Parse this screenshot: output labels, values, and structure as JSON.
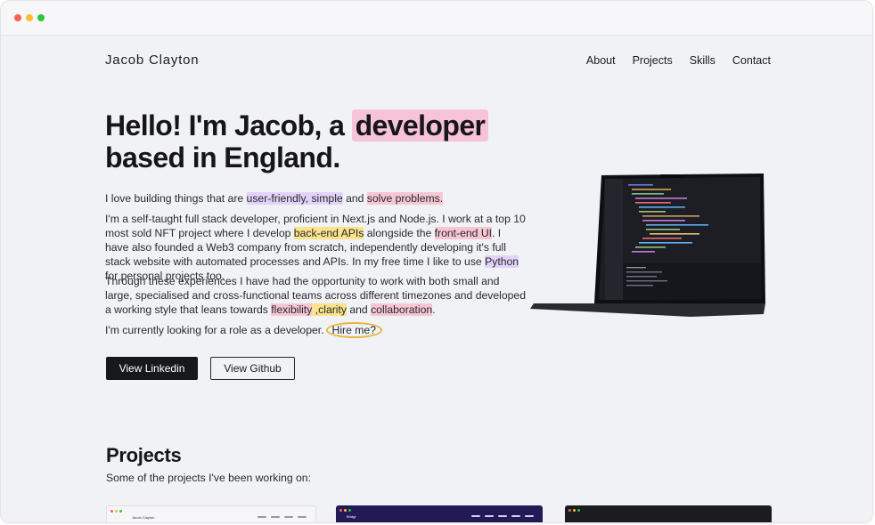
{
  "site": {
    "logo": "Jacob Clayton",
    "nav": [
      "About",
      "Projects",
      "Skills",
      "Contact"
    ]
  },
  "hero": {
    "title_pre": "Hello! I'm Jacob, a ",
    "title_highlight": "developer",
    "title_post": "based in England.",
    "p1": {
      "a": "I love building things that are ",
      "h1": "user-friendly, simple",
      "b": " and ",
      "h2": "solve problems."
    },
    "p2": {
      "a": "I'm a self-taught full stack developer, proficient in Next.js and Node.js. I work at a top 10 most sold NFT project where I develop ",
      "h1": "back-end APIs",
      "b": " alongside the ",
      "h2": "front-end UI",
      "c": ". I have also founded a Web3 company from scratch, independently developing it's full stack website with automated processes and APIs. In my free time I like to use ",
      "h3": "Python",
      "d": " for personal projects too."
    },
    "p3": {
      "a": "Through these experiences I have had the opportunity to work with both small and large, specialised and cross-functional teams across different timezones and developed a working style that leans towards ",
      "h1": "flexibility",
      "b": " ,",
      "h2": "clarity",
      "c": " and ",
      "h3": "collaboration",
      "d": "."
    },
    "p4": {
      "a": "I'm currently looking for a role as a developer.",
      "hire": "Hire me?"
    },
    "buttons": {
      "linkedin": "View Linkedin",
      "github": "View Github"
    }
  },
  "projects": {
    "title": "Projects",
    "subtitle": "Some of the projects I've been working on:",
    "card_labels": [
      "Jacob Clayton",
      "Bridgr"
    ]
  },
  "colors": {
    "dark": "#17181c",
    "highlight_pink": "#f6c6d3",
    "highlight_purple": "#e2d2f8",
    "highlight_yellow": "#fae38a",
    "circle": "#e5b53e"
  },
  "icons": [
    "window-close-dot",
    "window-minimize-dot",
    "window-maximize-dot",
    "laptop-image"
  ]
}
